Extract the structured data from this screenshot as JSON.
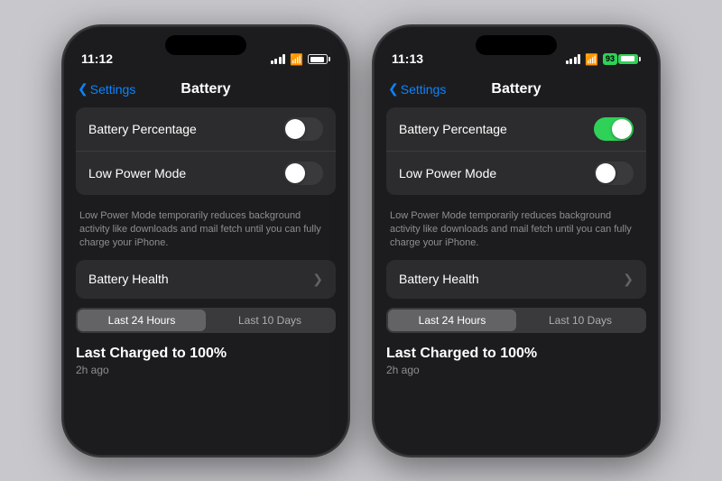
{
  "phones": [
    {
      "id": "phone-left",
      "time": "11:12",
      "battery_percentage_toggle": "off",
      "low_power_toggle": "off",
      "battery_fill_width": "90%",
      "show_battery_badge": false
    },
    {
      "id": "phone-right",
      "time": "11:13",
      "battery_percentage_toggle": "on",
      "low_power_toggle": "off",
      "battery_fill_width": "93%",
      "show_battery_badge": true,
      "battery_badge_text": "93"
    }
  ],
  "nav": {
    "back_label": "Settings",
    "title": "Battery"
  },
  "settings": {
    "battery_percentage_label": "Battery Percentage",
    "low_power_label": "Low Power Mode",
    "description": "Low Power Mode temporarily reduces background activity like downloads and mail fetch until you can fully charge your iPhone.",
    "battery_health_label": "Battery Health",
    "segment_24h": "Last 24 Hours",
    "segment_10d": "Last 10 Days",
    "charged_title": "Last Charged to 100%",
    "charged_time": "2h ago"
  }
}
